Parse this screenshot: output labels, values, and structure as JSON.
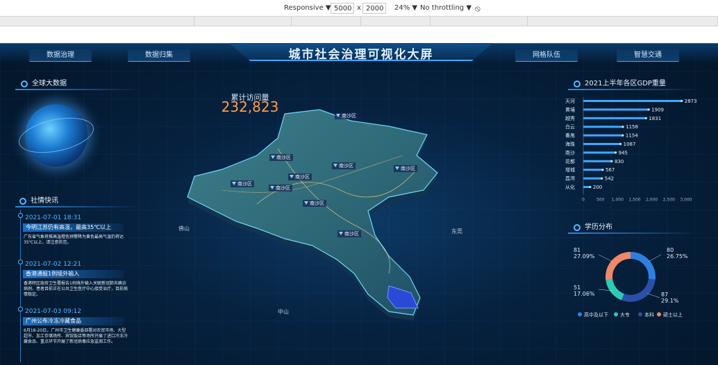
{
  "devtools": {
    "mode": "Responsive",
    "width": "5000",
    "times": "x",
    "height": "2000",
    "zoom": "24%",
    "throttle": "No throttling"
  },
  "dashboard": {
    "title": "城市社会治理可视化大屏",
    "nav": [
      "数据治理",
      "数据归集",
      "网格队伍",
      "智慧交通"
    ],
    "globe_title": "全球大数据",
    "visits": {
      "label": "累计访问量",
      "value": "232,823"
    },
    "map": {
      "districts": [
        "南沙区",
        "南沙区",
        "南沙区",
        "南沙区",
        "南沙区",
        "南沙区",
        "南沙区",
        "南沙区",
        "南沙区",
        "南沙区"
      ],
      "places": [
        "佛山",
        "东莞",
        "中山"
      ]
    },
    "news": {
      "title": "社情快讯",
      "items": [
        {
          "time": "2021-07-01 18:31",
          "headline": "今明江苏仍有高温，最高35℃以上",
          "body": "广东省气象将推高温橙色预警降为黄色最高气温仍将达35℃以上，请注意防范。"
        },
        {
          "time": "2021-07-02 12:21",
          "headline": "香港通报1例境外输入",
          "body": "香港特区政府卫生署报告1例境外输入关联新冠肺炎确诊病例，患者目前正在公共卫生医疗中心接受治疗，目前病情稳定。"
        },
        {
          "time": "2021-07-03 09:12",
          "headline": "广州公布冷冻冷藏食品",
          "body": "6月18-20日，广州市卫生健康委部署对农贸市场、大型超市、加工存储场所、宾馆饭店等场所开展了进口冷冻冷藏食品、重点环节开展了新冠病毒应急监测工作。"
        }
      ]
    },
    "gdp": {
      "title": "2021上半年各区GDP重量",
      "chart_data": {
        "type": "bar",
        "orientation": "horizontal",
        "categories": [
          "天河",
          "黄埔",
          "越秀",
          "白云",
          "番禺",
          "海珠",
          "南沙",
          "花都",
          "增城",
          "荔湾",
          "从化"
        ],
        "values": [
          2873,
          1909,
          1831,
          1158,
          1154,
          1087,
          945,
          830,
          567,
          542,
          200
        ],
        "xlim": [
          0,
          3000
        ],
        "xticks": [
          "0",
          "500",
          "1,000",
          "1,500",
          "2,000",
          "2,500",
          "3,000"
        ],
        "bar_color": "#3fa8ff"
      }
    },
    "edu": {
      "title": "学历分布",
      "chart_data": {
        "type": "pie",
        "donut": true,
        "labels": [
          "高中及以下",
          "大专",
          "本科",
          "硕士以上"
        ],
        "values": [
          80,
          51,
          87,
          81
        ],
        "percent_labels": [
          "26.75%",
          "17.06%",
          "29.1%",
          "27.09%"
        ],
        "colors": [
          "#2f7fe0",
          "#2ec9b5",
          "#2a4fa8",
          "#f0876a"
        ]
      }
    }
  }
}
